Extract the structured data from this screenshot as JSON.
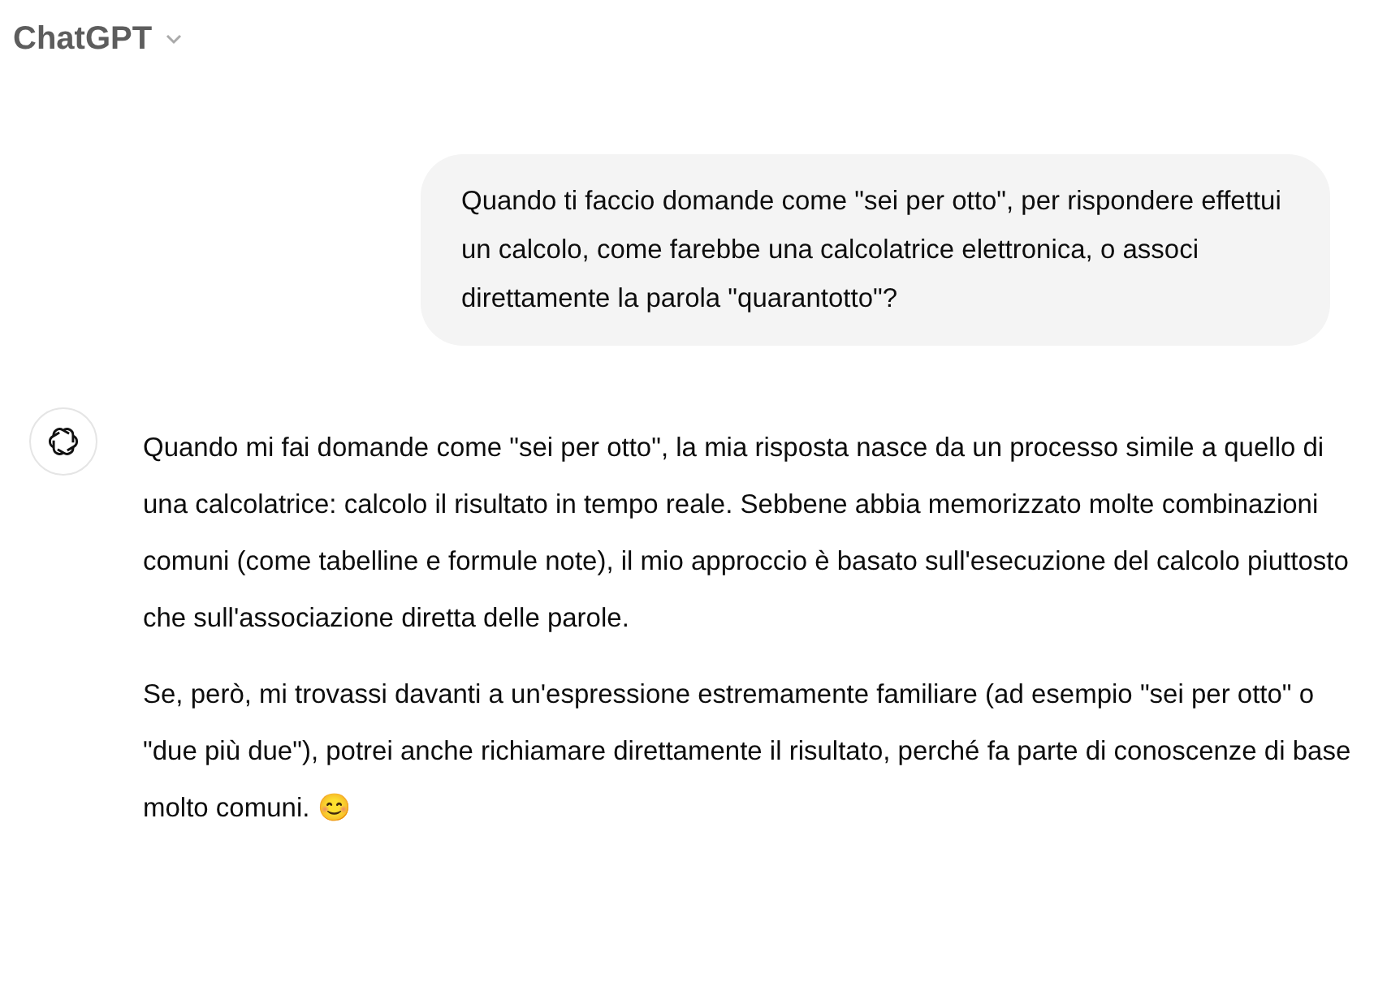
{
  "header": {
    "title": "ChatGPT"
  },
  "messages": [
    {
      "kind": "user",
      "paragraphs": [
        "Quando ti faccio domande come \"sei per otto\", per rispondere effettui un calcolo, come farebbe una calcolatrice elettronica, o associ  direttamente la parola \"quarantotto\"?"
      ]
    },
    {
      "kind": "assistant",
      "paragraphs": [
        "Quando mi fai domande come \"sei per otto\", la mia risposta nasce da un processo simile a quello di una calcolatrice: calcolo il risultato in tempo reale. Sebbene abbia memorizzato molte combinazioni comuni (come tabelline e formule note), il mio approccio è basato sull'esecuzione del calcolo piuttosto che sull'associazione diretta delle parole.",
        "Se, però, mi trovassi davanti a un'espressione estremamente familiare (ad esempio \"sei per otto\" o \"due più due\"), potrei anche richiamare direttamente il risultato, perché fa parte di conoscenze di base molto comuni. 😊"
      ]
    }
  ]
}
